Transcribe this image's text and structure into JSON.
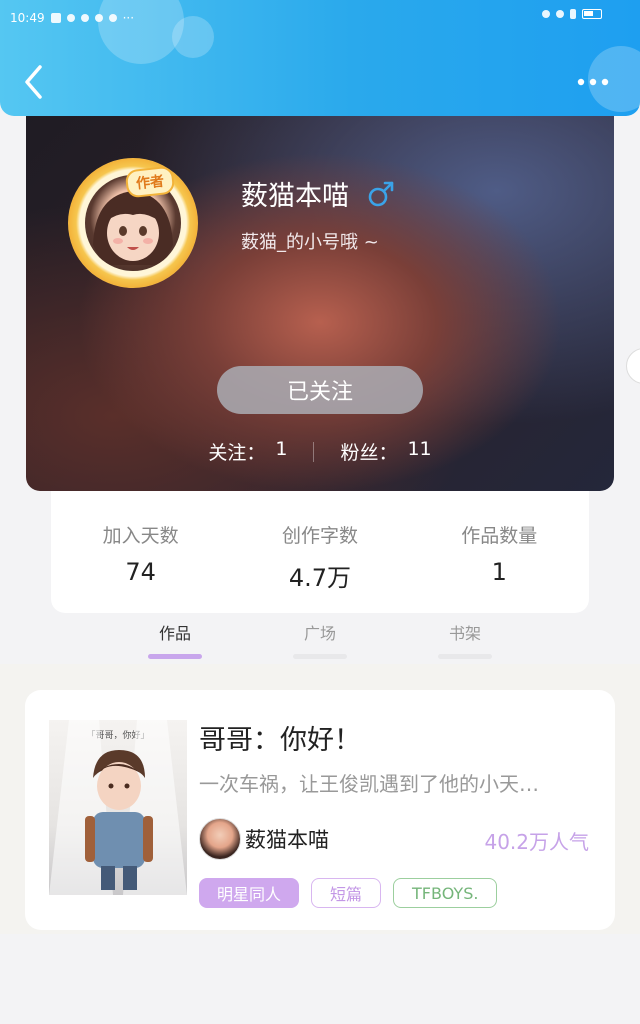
{
  "status_bar": {
    "time": "10:49",
    "more": "···"
  },
  "header": {
    "back_icon": "chevron-left-icon",
    "more_icon": "more-dots-icon"
  },
  "profile": {
    "author_badge": "作者",
    "name": "薮猫本喵",
    "gender_icon": "male-icon",
    "gender_color": "#3aa3e8",
    "bio": "薮猫_的小号哦 ~",
    "follow_button": "已关注",
    "following_label": "关注：",
    "following_count": "1",
    "fans_label": "粉丝：",
    "fans_count": "11"
  },
  "stats": [
    {
      "label": "加入天数",
      "value": "74"
    },
    {
      "label": "创作字数",
      "value": "4.7万"
    },
    {
      "label": "作品数量",
      "value": "1"
    }
  ],
  "tabs": [
    {
      "label": "作品",
      "active": true
    },
    {
      "label": "广场",
      "active": false
    },
    {
      "label": "书架",
      "active": false
    }
  ],
  "book": {
    "cover_title": "「哥哥，你好」",
    "title": "哥哥：你好！",
    "description": "一次车祸，让王俊凯遇到了他的小天…",
    "author": "薮猫本喵",
    "popularity": "40.2万人气",
    "tags": [
      "明星同人",
      "短篇",
      "TFBOYS."
    ]
  },
  "colors": {
    "accent": "#c8a6ec",
    "header": "#2aa9ec"
  }
}
